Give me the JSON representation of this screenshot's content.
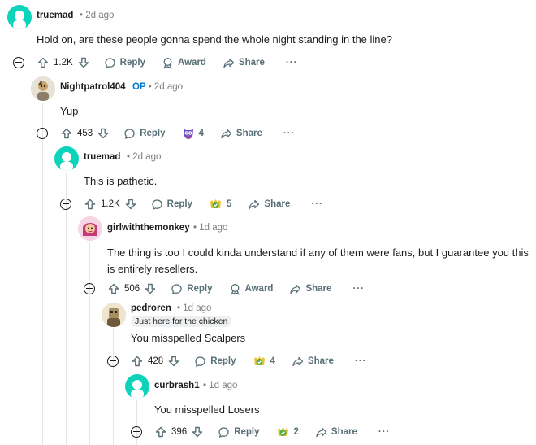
{
  "comments": [
    {
      "author": "truemad",
      "op": "",
      "time": "2d ago",
      "flair": "",
      "body": "Hold on, are these people gonna spend the whole night standing in the line?",
      "votes": "1.2K",
      "reply": "Reply",
      "award_label": "Award",
      "award_count": "",
      "share": "Share",
      "more": "···",
      "avatar_color": "#0dd3bb"
    },
    {
      "author": "Nightpatrol404",
      "op": "OP",
      "time": "2d ago",
      "flair": "",
      "body": "Yup",
      "votes": "453",
      "reply": "Reply",
      "award_label": "",
      "award_count": "4",
      "share": "Share",
      "more": "···",
      "avatar_color": "#8a7e6a"
    },
    {
      "author": "truemad",
      "op": "",
      "time": "2d ago",
      "flair": "",
      "body": "This is pathetic.",
      "votes": "1.2K",
      "reply": "Reply",
      "award_label": "",
      "award_count": "5",
      "share": "Share",
      "more": "···",
      "avatar_color": "#0dd3bb"
    },
    {
      "author": "girlwiththemonkey",
      "op": "",
      "time": "1d ago",
      "flair": "",
      "body": "The thing is too I could kinda understand if any of them were fans, but I guarantee you this is entirely resellers.",
      "votes": "506",
      "reply": "Reply",
      "award_label": "Award",
      "award_count": "",
      "share": "Share",
      "more": "···",
      "avatar_color": "#c43a7a"
    },
    {
      "author": "pedroren",
      "op": "",
      "time": "1d ago",
      "flair": "Just here for the chicken",
      "body": "You misspelled Scalpers",
      "votes": "428",
      "reply": "Reply",
      "award_label": "",
      "award_count": "4",
      "share": "Share",
      "more": "···",
      "avatar_color": "#a88d5e"
    },
    {
      "author": "curbrash1",
      "op": "",
      "time": "1d ago",
      "flair": "",
      "body": "You misspelled Losers",
      "votes": "396",
      "reply": "Reply",
      "award_label": "",
      "award_count": "2",
      "share": "Share",
      "more": "···",
      "avatar_color": "#0dd3bb"
    }
  ]
}
